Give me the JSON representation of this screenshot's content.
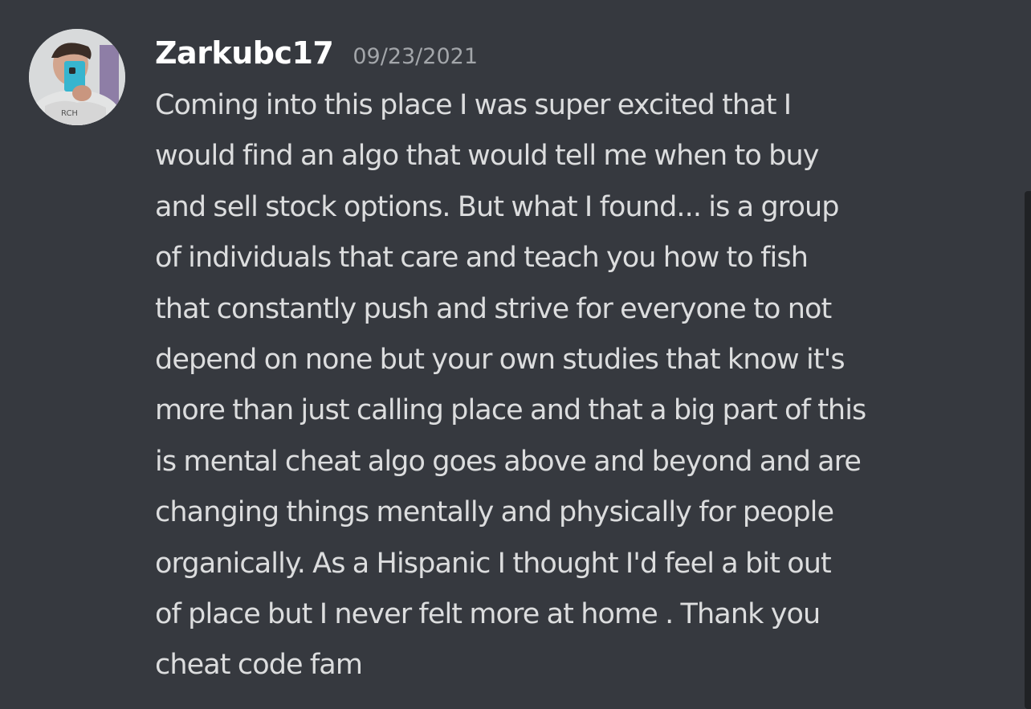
{
  "message": {
    "author": "Zarkubc17",
    "timestamp": "09/23/2021",
    "content": "Coming into this place I was super excited that I\nwould find an algo that would tell me when to buy\nand sell stock options. But what I found... is a group\nof individuals that care and teach you how to fish\nthat constantly push and strive for everyone to not\ndepend on none but your own studies that know it's\nmore than just calling place and that a big part of this\nis mental cheat algo goes above and beyond and are\nchanging things mentally and physically for people\norganically. As a Hispanic I thought I'd feel a bit out\nof place but I never felt more at home . Thank you\ncheat code fam"
  },
  "avatar": {
    "icon": "user-selfie-avatar"
  },
  "colors": {
    "background": "#36393f",
    "username": "#ffffff",
    "timestamp": "#a3a6aa",
    "text": "#dcddde",
    "scrollbar": "#202225"
  }
}
